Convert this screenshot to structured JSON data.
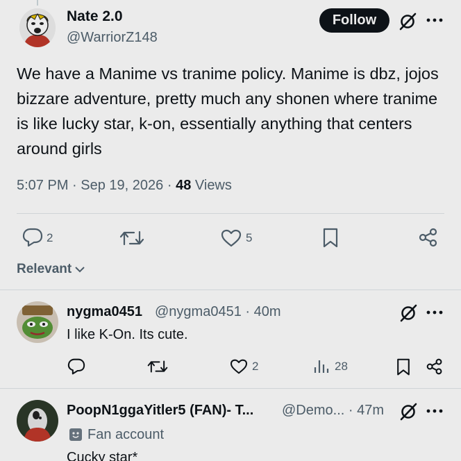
{
  "main_post": {
    "author_name": "Nate 2.0",
    "author_handle": "@WarriorZ148",
    "follow_label": "Follow",
    "text": "We have a Manime vs tranime policy. Manime is dbz, jojos bizzare adventure, pretty much any shonen where tranime is like lucky star, k-on, essentially anything that centers around girls",
    "time": "5:07 PM",
    "date": "Sep 19, 2026",
    "views_count": "48",
    "views_label": "Views",
    "replies": "2",
    "likes": "5"
  },
  "sort_label": "Relevant",
  "replies": [
    {
      "name": "nygma0451",
      "handle": "@nygma0451",
      "age": "40m",
      "text": "I like K-On. Its cute.",
      "likes": "2",
      "views": "28"
    },
    {
      "name": "PoopN1ggaYitler5 (FAN)- T...",
      "handle": "@Demo...",
      "age": "47m",
      "badge": "Fan account",
      "text": "Cucky star*"
    }
  ],
  "colors": {
    "primary_text": "#0f1419",
    "secondary_text": "#536471",
    "follow_bg": "#0f1419",
    "divider": "#e1e6ea"
  },
  "icons": [
    "grok-icon",
    "more-icon",
    "reply-icon",
    "retweet-icon",
    "like-icon",
    "bookmark-icon",
    "share-icon",
    "views-icon",
    "chevron-down-icon",
    "fan-account-icon"
  ]
}
